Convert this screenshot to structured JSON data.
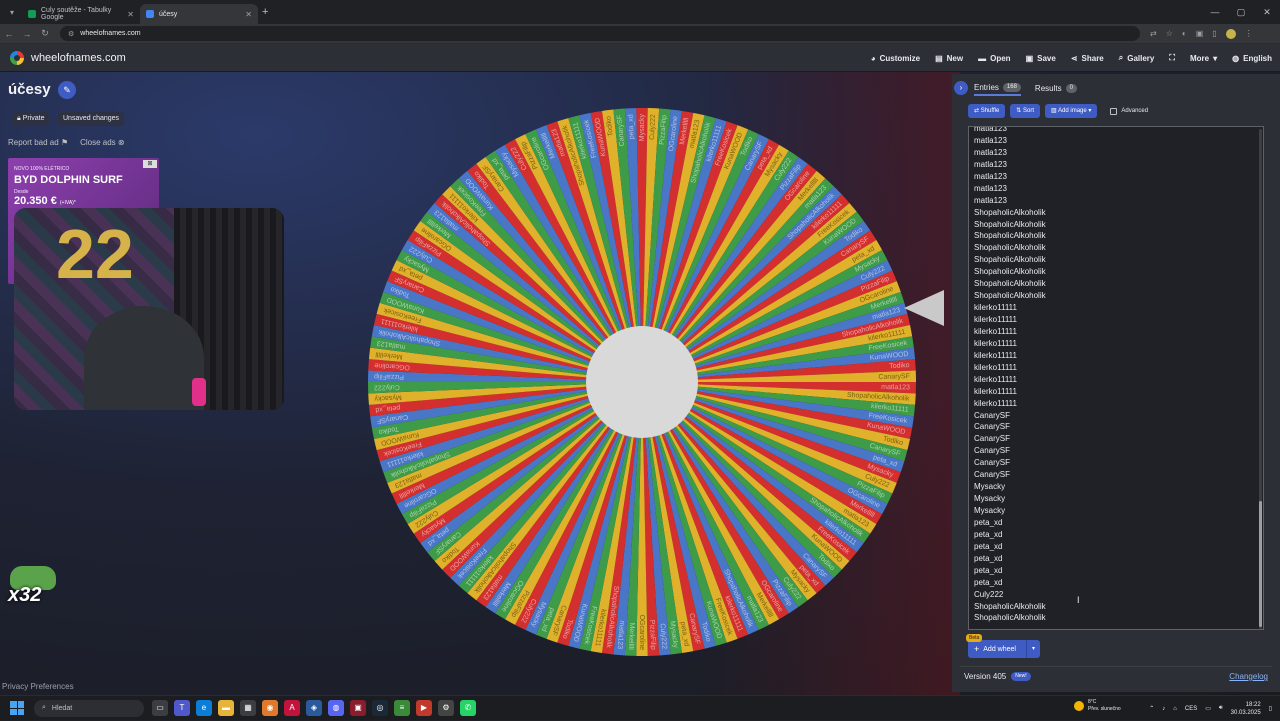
{
  "browser": {
    "tabs": [
      {
        "title": "Culy soutěže - Tabulky Google",
        "color": "#0f9d58"
      },
      {
        "title": "účesy",
        "color": "#4285f4"
      }
    ],
    "url": "wheelofnames.com"
  },
  "site": {
    "name": "wheelofnames.com",
    "menu": [
      "Customize",
      "New",
      "Open",
      "Save",
      "Share",
      "Gallery",
      "",
      "More",
      "English"
    ]
  },
  "wheel": {
    "title": "účesy",
    "chips": [
      "Private",
      "Unsaved changes"
    ],
    "report_ad": "Report bad ad",
    "close_ads": "Close ads",
    "colors": [
      "#d32f2f",
      "#e0b12a",
      "#3e9b47",
      "#4a76c8"
    ],
    "visible_names": [
      "matla123",
      "ShopaholicAlkoholik",
      "kilerko11111",
      "FreeKosicek",
      "KunaWOOD",
      "Todiko",
      "CanarySF",
      "peta_xd",
      "Mysacky",
      "Culy222",
      "PizzaFilip",
      "OGcaroline",
      "Merkelllll"
    ],
    "slice_count": 150
  },
  "ad": {
    "small": "NOVO 100% ELÉTRICO",
    "headline": "BYD DOLPHIN SURF",
    "pre": "Desde",
    "price": "20.350 €",
    "price_note": "(+IVA)*"
  },
  "webcam": {
    "balloon": "22"
  },
  "emote": {
    "label": "x32"
  },
  "privacy": "Privacy Preferences",
  "panel": {
    "tab_entries": "Entries",
    "entries_count": "168",
    "tab_results": "Results",
    "results_count": "0",
    "shuffle": "Shuffle",
    "sort": "Sort",
    "add_image": "Add image",
    "advanced": "Advanced",
    "entries": [
      "matla123",
      "matla123",
      "matla123",
      "matla123",
      "matla123",
      "matla123",
      "matla123",
      "ShopaholicAlkoholik",
      "ShopaholicAlkoholik",
      "ShopaholicAlkoholik",
      "ShopaholicAlkoholik",
      "ShopaholicAlkoholik",
      "ShopaholicAlkoholik",
      "ShopaholicAlkoholik",
      "ShopaholicAlkoholik",
      "kilerko11111",
      "kilerko11111",
      "kilerko11111",
      "kilerko11111",
      "kilerko11111",
      "kilerko11111",
      "kilerko11111",
      "kilerko11111",
      "kilerko11111",
      "CanarySF",
      "CanarySF",
      "CanarySF",
      "CanarySF",
      "CanarySF",
      "CanarySF",
      "Mysacky",
      "Mysacky",
      "Mysacky",
      "peta_xd",
      "peta_xd",
      "peta_xd",
      "peta_xd",
      "peta_xd",
      "peta_xd",
      "Culy222",
      "ShopaholicAlkoholik",
      "ShopaholicAlkoholik"
    ],
    "beta": "Beta",
    "add_wheel": "Add wheel",
    "version": "Version 405",
    "new_badge": "New!",
    "changelog": "Changelog"
  },
  "taskbar": {
    "search": "Hledat",
    "weather_temp": "8°C",
    "weather_desc": "Přev. slunečno",
    "lang": "CES",
    "time": "18:22",
    "date": "30.03.2025"
  }
}
